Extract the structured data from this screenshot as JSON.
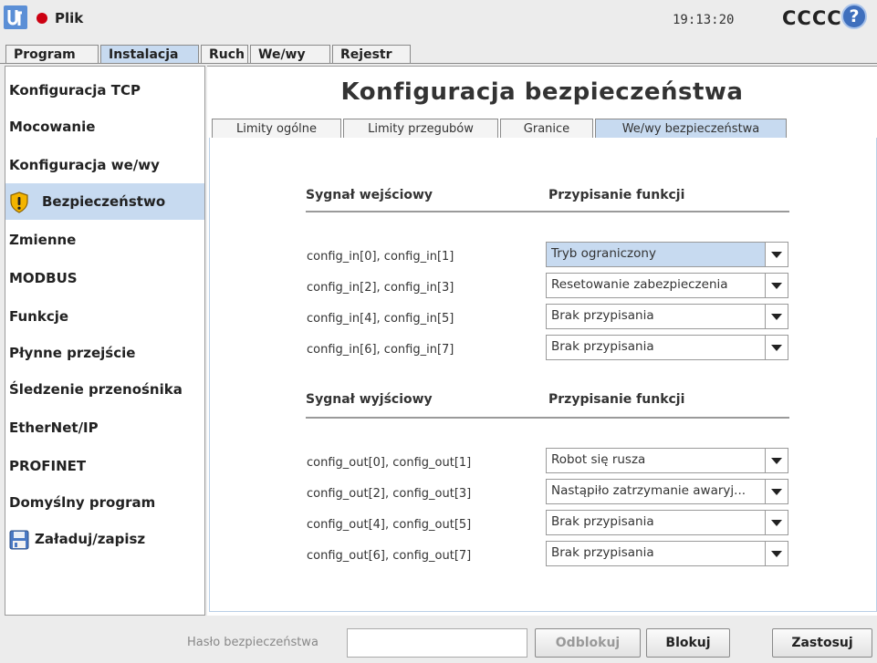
{
  "header": {
    "file_menu": "Plik",
    "time": "19:13:20",
    "robot_name": "CCCC",
    "help": "?"
  },
  "top_tabs": [
    "Program",
    "Instalacja",
    "Ruch",
    "We/wy",
    "Rejestr"
  ],
  "top_tabs_active": "Instalacja",
  "sidebar": {
    "items": [
      {
        "label": "Konfiguracja TCP"
      },
      {
        "label": "Mocowanie"
      },
      {
        "label": "Konfiguracja we/wy"
      },
      {
        "label": "Bezpieczeństwo",
        "icon": "warning-shield-icon",
        "active": true
      },
      {
        "label": "Zmienne"
      },
      {
        "label": "MODBUS"
      },
      {
        "label": "Funkcje"
      },
      {
        "label": "Płynne przejście"
      },
      {
        "label": "Śledzenie przenośnika"
      },
      {
        "label": "EtherNet/IP"
      },
      {
        "label": "PROFINET"
      },
      {
        "label": "Domyślny program"
      },
      {
        "label": "Załaduj/zapisz",
        "icon": "save-disk-icon"
      }
    ]
  },
  "main": {
    "title": "Konfiguracja bezpieczeństwa",
    "tabs": [
      "Limity ogólne",
      "Limity przegubów",
      "Granice",
      "We/wy bezpieczeństwa"
    ],
    "active_tab": "We/wy bezpieczeństwa",
    "inputs": {
      "col_signal": "Sygnał wejściowy",
      "col_function": "Przypisanie funkcji",
      "rows": [
        {
          "signal": "config_in[0], config_in[1]",
          "function": "Tryb ograniczony"
        },
        {
          "signal": "config_in[2], config_in[3]",
          "function": "Resetowanie zabezpieczenia"
        },
        {
          "signal": "config_in[4], config_in[5]",
          "function": "Brak przypisania"
        },
        {
          "signal": "config_in[6], config_in[7]",
          "function": "Brak przypisania"
        }
      ]
    },
    "outputs": {
      "col_signal": "Sygnał wyjściowy",
      "col_function": "Przypisanie funkcji",
      "rows": [
        {
          "signal": "config_out[0], config_out[1]",
          "function": "Robot się rusza"
        },
        {
          "signal": "config_out[2], config_out[3]",
          "function": "Nastąpiło zatrzymanie awaryj..."
        },
        {
          "signal": "config_out[4], config_out[5]",
          "function": "Brak przypisania"
        },
        {
          "signal": "config_out[6], config_out[7]",
          "function": "Brak przypisania"
        }
      ]
    }
  },
  "footer": {
    "password_label": "Hasło bezpieczeństwa",
    "password_value": "",
    "unlock": "Odblokuj",
    "lock": "Blokuj",
    "apply": "Zastosuj"
  },
  "colors": {
    "active_bg": "#c7daf0",
    "status_dot": "#cc0011",
    "help_blue": "#3f6fbd"
  }
}
